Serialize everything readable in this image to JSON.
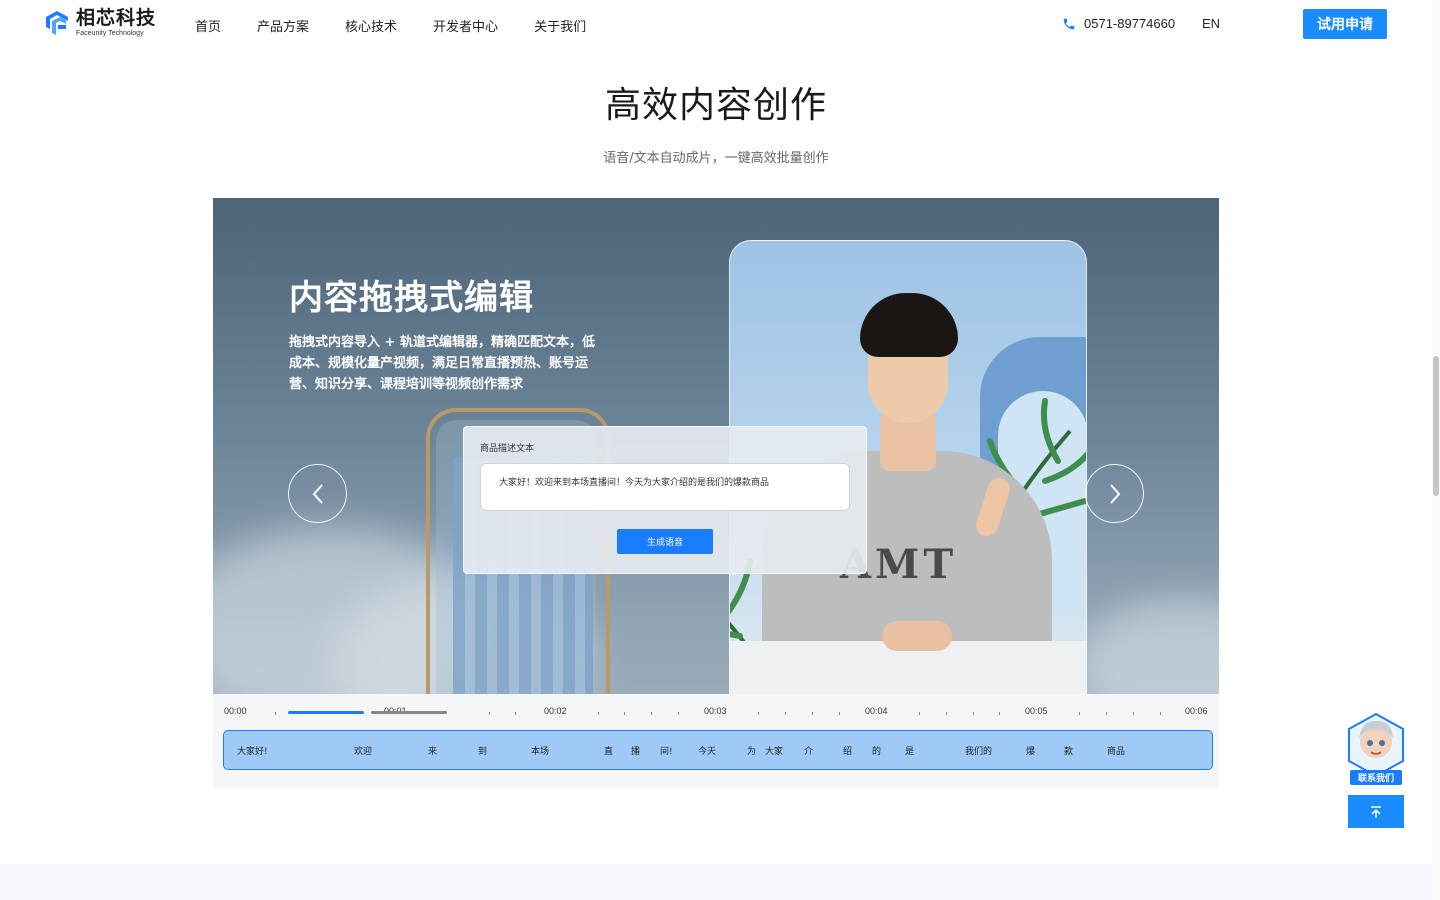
{
  "header": {
    "logo_cn": "相芯科技",
    "logo_en": "Faceunity Technology",
    "nav": [
      {
        "label": "首页"
      },
      {
        "label": "产品方案"
      },
      {
        "label": "核心技术"
      },
      {
        "label": "开发者中心"
      },
      {
        "label": "关于我们"
      }
    ],
    "phone": "0571-89774660",
    "lang": "EN",
    "trial_button": "试用申请"
  },
  "section": {
    "title": "高效内容创作",
    "subtitle": "语音/文本自动成片，一键高效批量创作"
  },
  "showcase": {
    "title": "内容拖拽式编辑",
    "desc": "拖拽式内容导入 + 轨道式编辑器，精确匹配文本，低成本、规模化量产视频，满足日常直播预热、账号运营、知识分享、课程培训等视频创作需求",
    "sweater_text": "AMT",
    "panel": {
      "label": "商品描述文本",
      "input_value": "大家好！欢迎来到本场直播间！今天为大家介绍的是我们的爆款商品",
      "generate_button": "生成语音"
    },
    "timeline": {
      "labels": [
        "00:00",
        "00:01",
        "00:02",
        "00:03",
        "00:04",
        "00:05",
        "00:06"
      ],
      "words": [
        "大家好!",
        "欢迎",
        "来",
        "到",
        "本场",
        "直",
        "播",
        "间!",
        "今天",
        "为",
        "大家",
        "介",
        "绍",
        "的",
        "是",
        "我们的",
        "爆",
        "款",
        "商品"
      ]
    }
  },
  "widgets": {
    "contact_label": "联系我们"
  },
  "colors": {
    "accent": "#1a8cff",
    "text": "#222222"
  }
}
